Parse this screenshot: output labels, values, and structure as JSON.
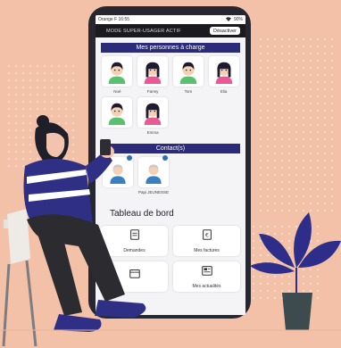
{
  "status_bar": {
    "carrier": "Orange F",
    "time": "16:55",
    "battery": "90%"
  },
  "super_user_bar": {
    "label": "MODE SUPER-USAGER ACTIF",
    "deactivate_label": "Désactiver"
  },
  "dependents": {
    "title": "Mes personnes à charge",
    "people": [
      {
        "name": "Noé",
        "gender": "boy"
      },
      {
        "name": "Fanny",
        "gender": "girl"
      },
      {
        "name": "Tom",
        "gender": "boy"
      },
      {
        "name": "Elia",
        "gender": "girl"
      },
      {
        "name": "",
        "gender": "boy"
      },
      {
        "name": "Emma",
        "gender": "girl"
      }
    ]
  },
  "contacts": {
    "title": "Contact(s)",
    "people": [
      {
        "name": ""
      },
      {
        "name": "Papi JEUNESSE"
      }
    ]
  },
  "dashboard": {
    "title": "Tableau de bord",
    "tiles": [
      {
        "label": "Demandes",
        "icon": "document-icon"
      },
      {
        "label": "Mes factures",
        "icon": "invoice-icon"
      },
      {
        "label": "",
        "icon": "calendar-icon"
      },
      {
        "label": "Mes actualités",
        "icon": "news-icon"
      }
    ]
  },
  "colors": {
    "accent": "#2b2b7a",
    "background": "#f3c1a8",
    "phone": "#262730",
    "plant": "#2e2e8a",
    "pot": "#3d4a4e"
  }
}
